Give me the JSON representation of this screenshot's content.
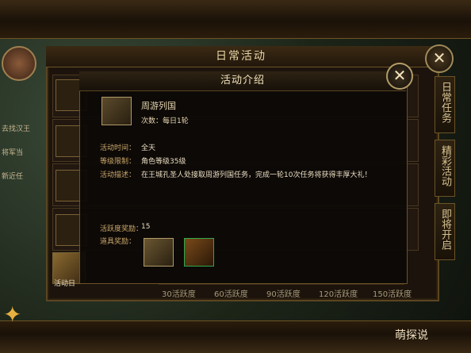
{
  "outer_panel": {
    "title": "日常活动"
  },
  "dialog": {
    "title": "活动介绍",
    "quest_name": "周游列国",
    "quest_count": "次数：每日1轮",
    "fields": [
      {
        "label": "活动时间：",
        "value": "全天"
      },
      {
        "label": "等级限制：",
        "value": "角色等级35级"
      },
      {
        "label": "活动描述：",
        "value": "在王城孔圣人处接取周游列国任务，完成一轮10次任务将获得丰厚大礼！"
      },
      {
        "label": "活跃度奖励：",
        "value": "15"
      },
      {
        "label": "道具奖励：",
        "value": ""
      }
    ]
  },
  "right_tabs": [
    "日常任务",
    "精彩活动",
    "即将开启"
  ],
  "left_sidebar": [
    "去找汉王",
    "将军当",
    "新近任"
  ],
  "progress_labels": [
    "30活跃度",
    "60活跃度",
    "90活跃度",
    "120活跃度",
    "150活跃度"
  ],
  "bottom_left_label": "活动日",
  "watermark": "萌探说",
  "colors": {
    "accent": "#caa86a",
    "text": "#e8dcc0",
    "border": "#6b5326"
  },
  "icons": [
    "close-icon",
    "scroll-icon",
    "treasure-chest-icon"
  ]
}
